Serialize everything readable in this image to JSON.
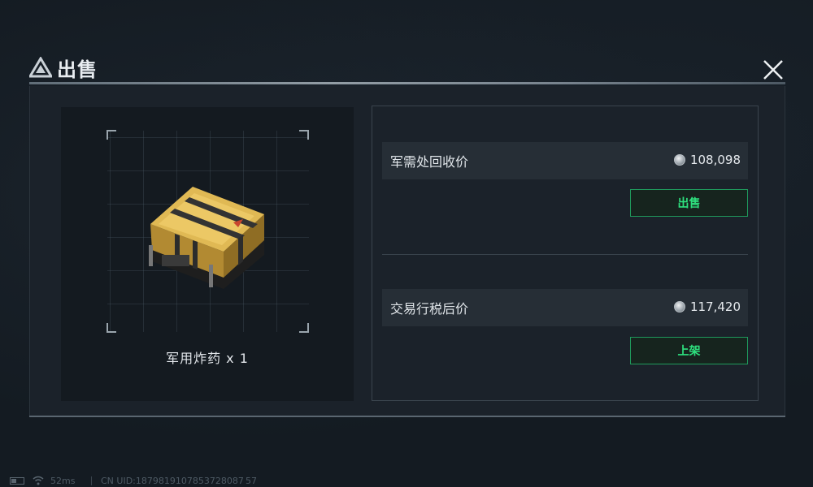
{
  "header": {
    "title": "出售",
    "title_icon": "warning-triangle-logo-icon",
    "close_icon": "close-icon"
  },
  "item": {
    "name": "军用炸药 x 1",
    "image": "yellow-explosives-crate"
  },
  "sell_options": [
    {
      "label": "军需处回收价",
      "price": "108,098",
      "button": "出售",
      "currency_icon": "coin-icon"
    },
    {
      "label": "交易行税后价",
      "price": "117,420",
      "button": "上架",
      "currency_icon": "coin-icon"
    }
  ],
  "status_bar": {
    "ping": "52ms",
    "uid": "CN UID:1879819107853728087 57"
  },
  "colors": {
    "background": "#141b22",
    "panel": "#1b222a",
    "accent_green": "#2ee07e",
    "button_border": "#1f9a5c"
  }
}
